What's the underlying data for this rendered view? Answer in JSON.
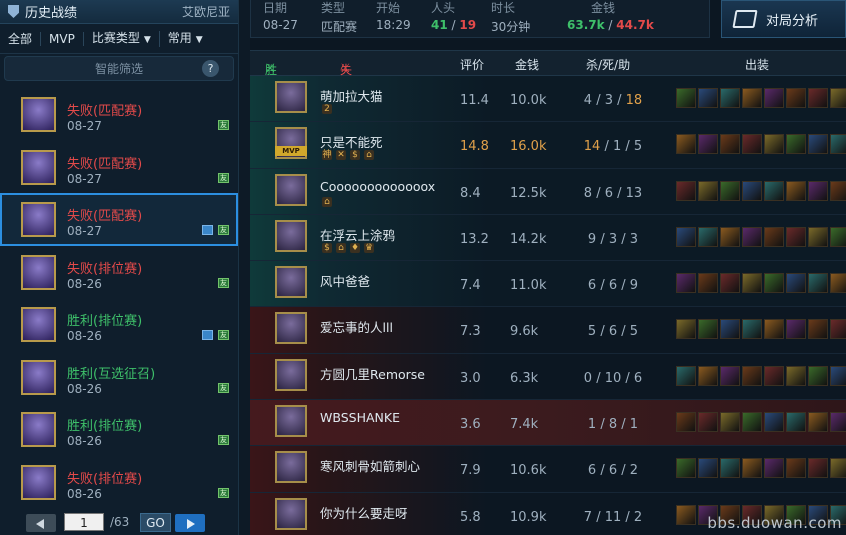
{
  "header": {
    "title": "历史战绩",
    "server": "艾欧尼亚"
  },
  "filters": {
    "all": "全部",
    "mvp": "MVP",
    "match_type": "比赛类型",
    "common": "常用"
  },
  "smart_filter": {
    "label": "智能筛选",
    "help": "?"
  },
  "history": [
    {
      "result": "失败",
      "mode": "(匹配赛)",
      "date": "08-27",
      "outcome": "lose",
      "has_photo": false
    },
    {
      "result": "失败",
      "mode": "(匹配赛)",
      "date": "08-27",
      "outcome": "lose",
      "has_photo": false
    },
    {
      "result": "失败",
      "mode": "(匹配赛)",
      "date": "08-27",
      "outcome": "lose",
      "has_photo": true,
      "selected": true
    },
    {
      "result": "失败",
      "mode": "(排位赛)",
      "date": "08-26",
      "outcome": "lose",
      "has_photo": false
    },
    {
      "result": "胜利",
      "mode": "(排位赛)",
      "date": "08-26",
      "outcome": "win",
      "has_photo": true
    },
    {
      "result": "胜利",
      "mode": "(互选征召)",
      "date": "08-26",
      "outcome": "win",
      "has_photo": false
    },
    {
      "result": "胜利",
      "mode": "(排位赛)",
      "date": "08-26",
      "outcome": "win",
      "has_photo": false
    },
    {
      "result": "失败",
      "mode": "(排位赛)",
      "date": "08-26",
      "outcome": "lose",
      "has_photo": false
    }
  ],
  "history_badge": "友",
  "pager": {
    "page": "1",
    "total": "/63",
    "go": "GO"
  },
  "summary": {
    "date_label": "日期",
    "date": "08-27",
    "type_label": "类型",
    "type": "匹配赛",
    "start_label": "开始",
    "start": "18:29",
    "kills_label": "人头",
    "kills_win": "41",
    "kills_sep": " / ",
    "kills_lose": "19",
    "duration_label": "时长",
    "duration": "30分钟",
    "gold_label": "金钱",
    "gold_win": "63.7k",
    "gold_sep": " / ",
    "gold_lose": "44.7k"
  },
  "analysis_button": "对局分析",
  "table_header": {
    "win_team": "胜利队伍",
    "lose_team": "失败队伍",
    "rating": "评价",
    "gold": "金钱",
    "kda": "杀/死/助",
    "items": "出装"
  },
  "players": [
    {
      "name": "萌加拉大猫",
      "rating": "11.4",
      "gold": "10.0k",
      "k": "4",
      "d": "3",
      "a": "18",
      "team": "win",
      "a_hl": true,
      "tags": [
        "2"
      ],
      "mvp": false
    },
    {
      "name": "只是不能死",
      "rating": "14.8",
      "gold": "16.0k",
      "k": "14",
      "d": "1",
      "a": "5",
      "team": "win",
      "hl": true,
      "tags": [
        "神",
        "✕",
        "$",
        "⌂"
      ],
      "mvp": true
    },
    {
      "name": "Cooooooooooooox",
      "rating": "8.4",
      "gold": "12.5k",
      "k": "8",
      "d": "6",
      "a": "13",
      "team": "win",
      "tags": [
        "⌂"
      ],
      "mvp": false
    },
    {
      "name": "在浮云上涂鸦",
      "rating": "13.2",
      "gold": "14.2k",
      "k": "9",
      "d": "3",
      "a": "3",
      "team": "win",
      "tags": [
        "$",
        "⌂",
        "♦",
        "♛"
      ],
      "mvp": false
    },
    {
      "name": "风中爸爸",
      "rating": "7.4",
      "gold": "11.0k",
      "k": "6",
      "d": "6",
      "a": "9",
      "team": "win",
      "tags": [],
      "mvp": false
    },
    {
      "name": "爱忘事的人lll",
      "rating": "7.3",
      "gold": "9.6k",
      "k": "5",
      "d": "6",
      "a": "5",
      "team": "lose",
      "tags": [],
      "mvp": false
    },
    {
      "name": "方圆几里Remorse",
      "rating": "3.0",
      "gold": "6.3k",
      "k": "0",
      "d": "10",
      "a": "6",
      "team": "lose",
      "tags": [],
      "mvp": false
    },
    {
      "name": "WBSSHANKE",
      "rating": "3.6",
      "gold": "7.4k",
      "k": "1",
      "d": "8",
      "a": "1",
      "team": "lose",
      "self": true,
      "tags": [],
      "mvp": false
    },
    {
      "name": "寒风刺骨如箭刺心",
      "rating": "7.9",
      "gold": "10.6k",
      "k": "6",
      "d": "6",
      "a": "2",
      "team": "lose",
      "tags": [],
      "mvp": false
    },
    {
      "name": "你为什么要走呀",
      "rating": "5.8",
      "gold": "10.9k",
      "k": "7",
      "d": "11",
      "a": "2",
      "team": "lose",
      "tags": [],
      "mvp": false
    }
  ],
  "mvp_label": "MVP",
  "watermark": "bbs.duowan.com",
  "colors": {
    "win": "#3ec06a",
    "lose": "#e24a4a",
    "highlight": "#e0a04a",
    "selected_border": "#2c8fe0"
  }
}
